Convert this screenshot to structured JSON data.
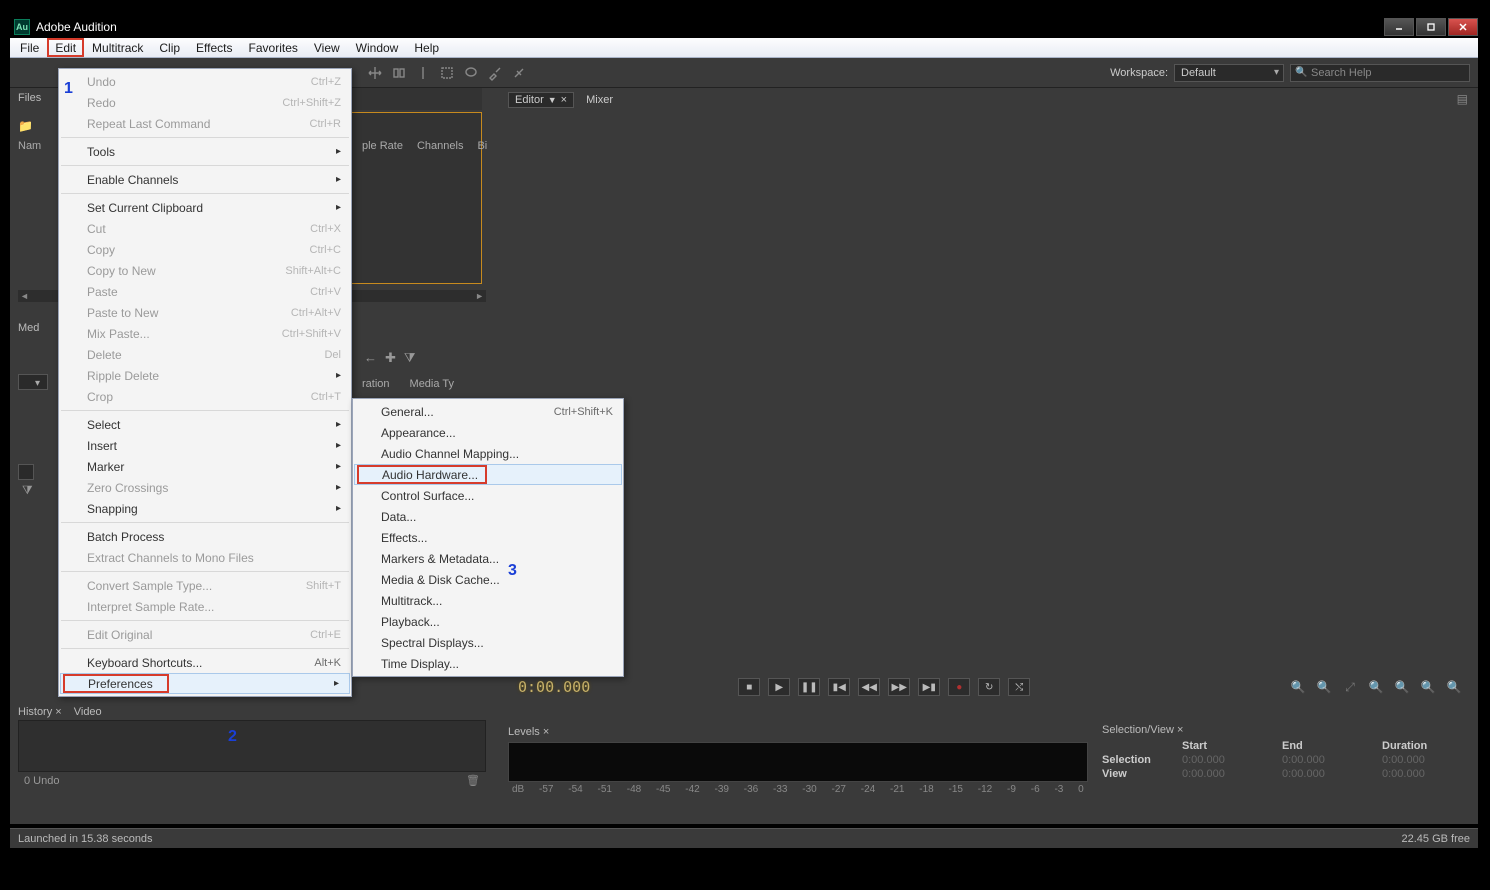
{
  "app": {
    "title": "Adobe Audition",
    "icon_text": "Au"
  },
  "window_controls": {
    "min": "minimize",
    "max": "maximize",
    "close": "close"
  },
  "menubar": [
    "File",
    "Edit",
    "Multitrack",
    "Clip",
    "Effects",
    "Favorites",
    "View",
    "Window",
    "Help"
  ],
  "toolbar": {
    "workspace_label": "Workspace:",
    "workspace_value": "Default",
    "search_placeholder": "Search Help"
  },
  "panels": {
    "files": {
      "tab": "Files",
      "col_name": "Nam",
      "cols_right": [
        "ple Rate",
        "Channels",
        "Bi"
      ]
    },
    "media": {
      "tab": "Med",
      "cols_right": [
        "ration",
        "Media Ty"
      ]
    },
    "editor": {
      "tab": "Editor",
      "mixer": "Mixer"
    },
    "history": {
      "tabs": [
        "History",
        "Video"
      ],
      "undo": "0 Undo"
    },
    "levels": {
      "tab": "Levels",
      "ticks": [
        "dB",
        "-57",
        "-54",
        "-51",
        "-48",
        "-45",
        "-42",
        "-39",
        "-36",
        "-33",
        "-30",
        "-27",
        "-24",
        "-21",
        "-18",
        "-15",
        "-12",
        "-9",
        "-6",
        "-3",
        "0"
      ]
    },
    "selview": {
      "tab": "Selection/View",
      "headers": [
        "",
        "Start",
        "End",
        "Duration"
      ],
      "rows": [
        {
          "label": "Selection",
          "start": "0:00.000",
          "end": "0:00.000",
          "dur": "0:00.000"
        },
        {
          "label": "View",
          "start": "0:00.000",
          "end": "0:00.000",
          "dur": "0:00.000"
        }
      ]
    }
  },
  "transport": {
    "timecode": "0:00.000"
  },
  "status": {
    "left": "Launched in 15.38 seconds",
    "right": "22.45 GB free"
  },
  "edit_menu": [
    {
      "label": "Undo",
      "shortcut": "Ctrl+Z",
      "disabled": true
    },
    {
      "label": "Redo",
      "shortcut": "Ctrl+Shift+Z",
      "disabled": true
    },
    {
      "label": "Repeat Last Command",
      "shortcut": "Ctrl+R",
      "disabled": true
    },
    {
      "sep": true
    },
    {
      "label": "Tools",
      "submenu": true
    },
    {
      "sep": true
    },
    {
      "label": "Enable Channels",
      "submenu": true
    },
    {
      "sep": true
    },
    {
      "label": "Set Current Clipboard",
      "submenu": true
    },
    {
      "label": "Cut",
      "shortcut": "Ctrl+X",
      "disabled": true
    },
    {
      "label": "Copy",
      "shortcut": "Ctrl+C",
      "disabled": true
    },
    {
      "label": "Copy to New",
      "shortcut": "Shift+Alt+C",
      "disabled": true
    },
    {
      "label": "Paste",
      "shortcut": "Ctrl+V",
      "disabled": true
    },
    {
      "label": "Paste to New",
      "shortcut": "Ctrl+Alt+V",
      "disabled": true
    },
    {
      "label": "Mix Paste...",
      "shortcut": "Ctrl+Shift+V",
      "disabled": true
    },
    {
      "label": "Delete",
      "shortcut": "Del",
      "disabled": true
    },
    {
      "label": "Ripple Delete",
      "submenu": true,
      "disabled": true
    },
    {
      "label": "Crop",
      "shortcut": "Ctrl+T",
      "disabled": true
    },
    {
      "sep": true
    },
    {
      "label": "Select",
      "submenu": true
    },
    {
      "label": "Insert",
      "submenu": true
    },
    {
      "label": "Marker",
      "submenu": true
    },
    {
      "label": "Zero Crossings",
      "submenu": true,
      "disabled": true
    },
    {
      "label": "Snapping",
      "submenu": true
    },
    {
      "sep": true
    },
    {
      "label": "Batch Process"
    },
    {
      "label": "Extract Channels to Mono Files",
      "disabled": true
    },
    {
      "sep": true
    },
    {
      "label": "Convert Sample Type...",
      "shortcut": "Shift+T",
      "disabled": true
    },
    {
      "label": "Interpret Sample Rate...",
      "disabled": true
    },
    {
      "sep": true
    },
    {
      "label": "Edit Original",
      "shortcut": "Ctrl+E",
      "disabled": true
    },
    {
      "sep": true
    },
    {
      "label": "Keyboard Shortcuts...",
      "shortcut": "Alt+K"
    },
    {
      "label": "Preferences",
      "submenu": true,
      "pref": true
    }
  ],
  "pref_menu": [
    {
      "label": "General...",
      "shortcut": "Ctrl+Shift+K"
    },
    {
      "label": "Appearance..."
    },
    {
      "label": "Audio Channel Mapping..."
    },
    {
      "label": "Audio Hardware...",
      "hl": true
    },
    {
      "label": "Control Surface..."
    },
    {
      "label": "Data..."
    },
    {
      "label": "Effects..."
    },
    {
      "label": "Markers & Metadata..."
    },
    {
      "label": "Media & Disk Cache..."
    },
    {
      "label": "Multitrack..."
    },
    {
      "label": "Playback..."
    },
    {
      "label": "Spectral Displays..."
    },
    {
      "label": "Time Display..."
    }
  ],
  "annotations": {
    "one": "1",
    "two": "2",
    "three": "3"
  }
}
